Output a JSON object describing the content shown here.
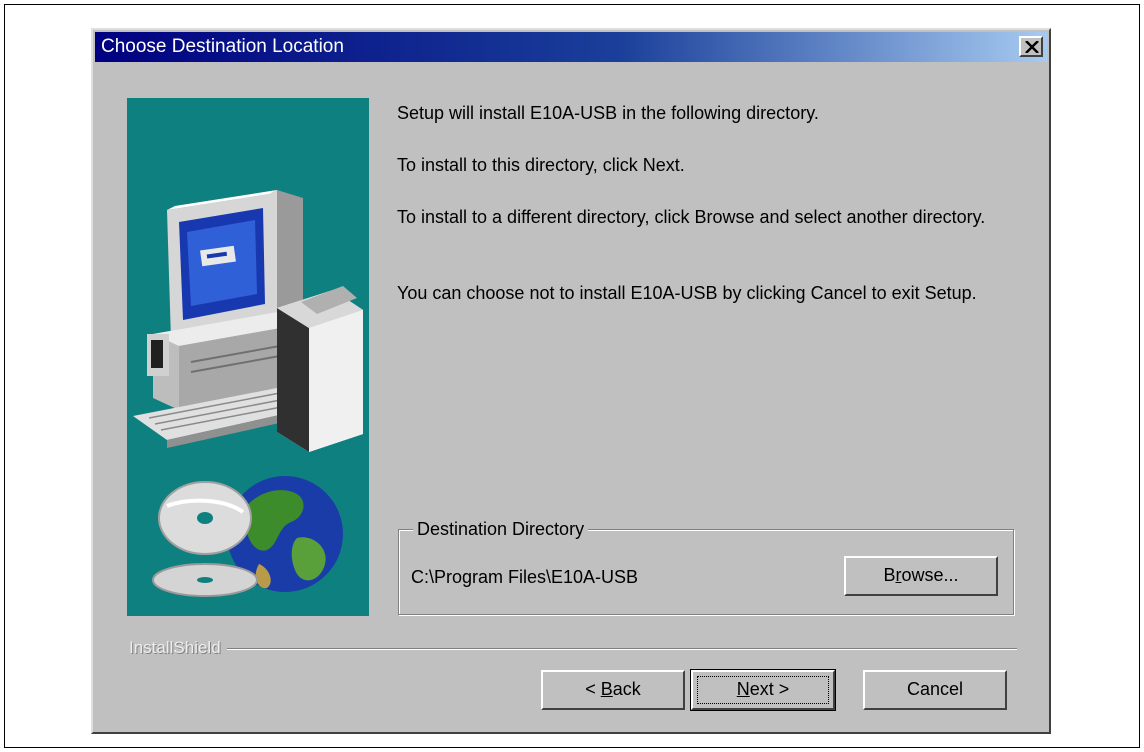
{
  "window": {
    "title": "Choose Destination Location",
    "close_label": "×"
  },
  "messages": [
    "Setup will install E10A-USB in the following directory.",
    "To install to this directory, click Next.",
    "To install to a different directory, click Browse and select another directory.",
    "You can choose not to install E10A-USB by clicking Cancel to exit Setup."
  ],
  "destination": {
    "group_label": "Destination Directory",
    "path": "C:\\Program Files\\E10A-USB",
    "browse": {
      "pre": "B",
      "accel": "r",
      "post": "owse..."
    }
  },
  "brand": "InstallShield",
  "buttons": {
    "back": {
      "pre": "< ",
      "accel": "B",
      "post": "ack"
    },
    "next": {
      "pre": "",
      "accel": "N",
      "post": "ext >"
    },
    "cancel": "Cancel"
  },
  "colors": {
    "dialog_bg": "#c0c0c0",
    "titlebar_start": "#000080",
    "titlebar_end": "#a6caf0",
    "art_bg": "#0f8080"
  }
}
